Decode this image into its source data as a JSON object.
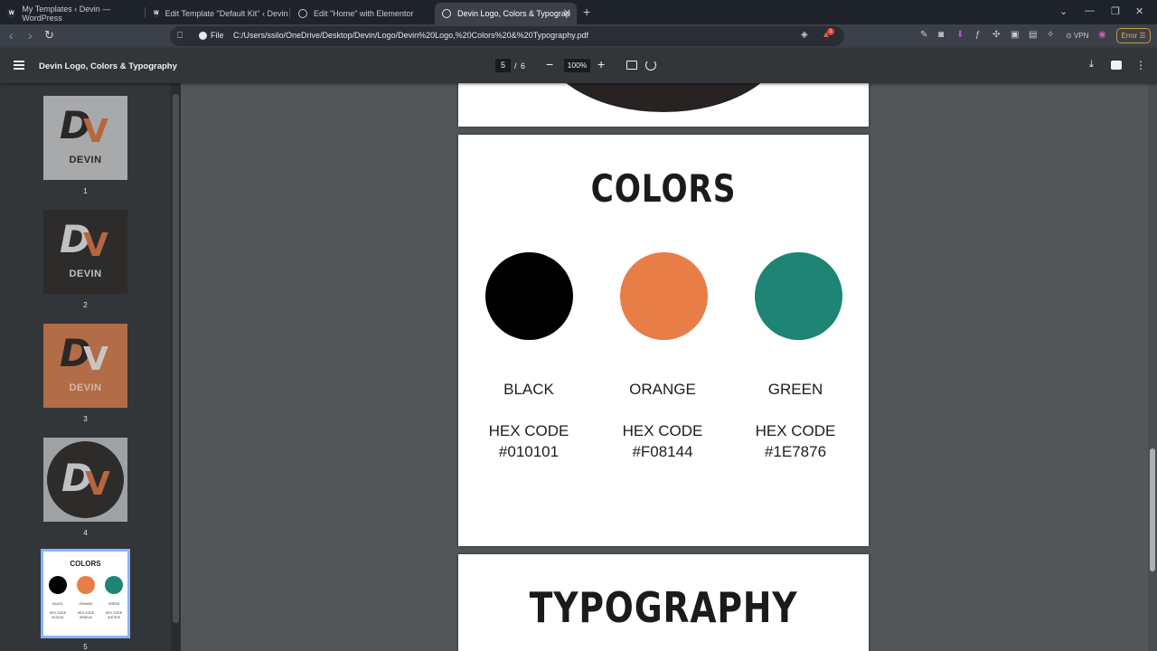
{
  "tabs": [
    {
      "label": "My Templates ‹ Devin — WordPress"
    },
    {
      "label": "Edit Template \"Default Kit\" ‹ Devin ‹"
    },
    {
      "label": "Edit \"Home\" with Elementor"
    },
    {
      "label": "Devin Logo, Colors & Typograp"
    }
  ],
  "address": {
    "scheme_label": "File",
    "url": "C:/Users/ssilo/OneDrive/Desktop/Devin/Logo/Devin%20Logo,%20Colors%20&%20Typography.pdf",
    "vpn_label": "VPN",
    "error_label": "Error",
    "badge_count": "1"
  },
  "pdf_toolbar": {
    "title": "Devin Logo, Colors & Typography",
    "current_page": "5",
    "separator": "/",
    "total_pages": "6",
    "zoom": "100%"
  },
  "thumbnails": [
    {
      "number": "1",
      "brand": "DEVIN",
      "bg": "#a7a9ab"
    },
    {
      "number": "2",
      "brand": "DEVIN",
      "bg": "#2e2b2b"
    },
    {
      "number": "3",
      "brand": "DEVIN",
      "bg": "#b26c47"
    },
    {
      "number": "4",
      "brand": "",
      "bg": "#9fa2a4"
    },
    {
      "number": "5",
      "title": "COLORS"
    }
  ],
  "page5": {
    "title": "COLORS",
    "swatches": [
      {
        "name": "BLACK",
        "hex_label": "HEX CODE",
        "hex": "#010101",
        "color": "#010101"
      },
      {
        "name": "ORANGE",
        "hex_label": "HEX CODE",
        "hex": "#F08144",
        "color": "#e87d47"
      },
      {
        "name": "GREEN",
        "hex_label": "HEX CODE",
        "hex": "#1E7876",
        "color": "#1e8474"
      }
    ]
  },
  "page6": {
    "title": "TYPOGRAPHY"
  },
  "colors": {
    "accent_orange": "#b8663f",
    "logo_dark": "#2a2727",
    "logo_light": "#bfc1c3"
  }
}
